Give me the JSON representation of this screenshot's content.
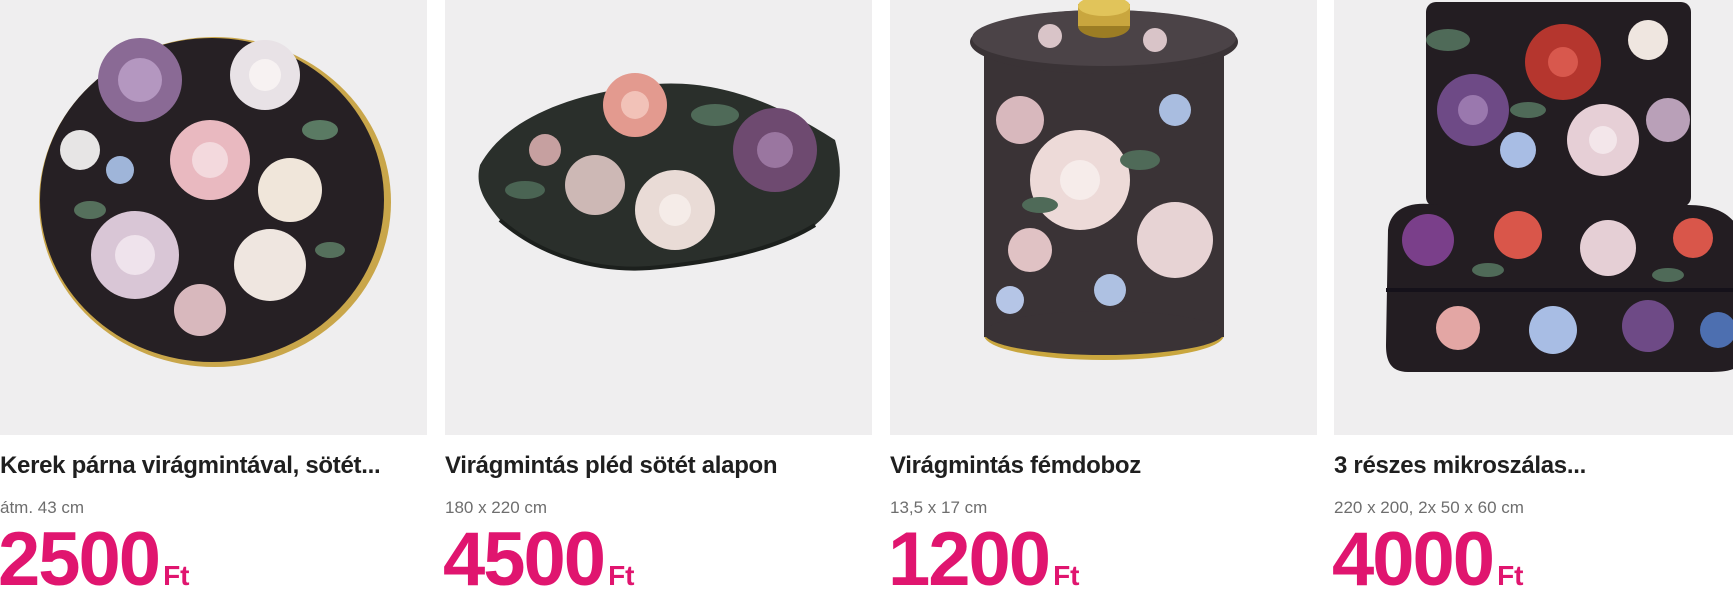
{
  "products": [
    {
      "title": "Kerek párna virágmintával, sötét...",
      "subtitle": "átm. 43 cm",
      "price": "2500",
      "currency": "Ft",
      "image_icon": "round-floral-pillow-icon"
    },
    {
      "title": "Virágmintás pléd sötét alapon",
      "subtitle": "180 x 220 cm",
      "price": "4500",
      "currency": "Ft",
      "image_icon": "folded-floral-blanket-icon"
    },
    {
      "title": "Virágmintás fémdoboz",
      "subtitle": "13,5 x 17 cm",
      "price": "1200",
      "currency": "Ft",
      "image_icon": "floral-tin-box-icon"
    },
    {
      "title": "3 részes mikroszálas...",
      "subtitle": "220 x 200, 2x 50 x 60 cm",
      "price": "4000",
      "currency": "Ft",
      "image_icon": "floral-bedding-set-icon"
    }
  ],
  "colors": {
    "price": "#e0156f",
    "image_background": "#efeeef",
    "fabric_dark": "#2a2328"
  }
}
